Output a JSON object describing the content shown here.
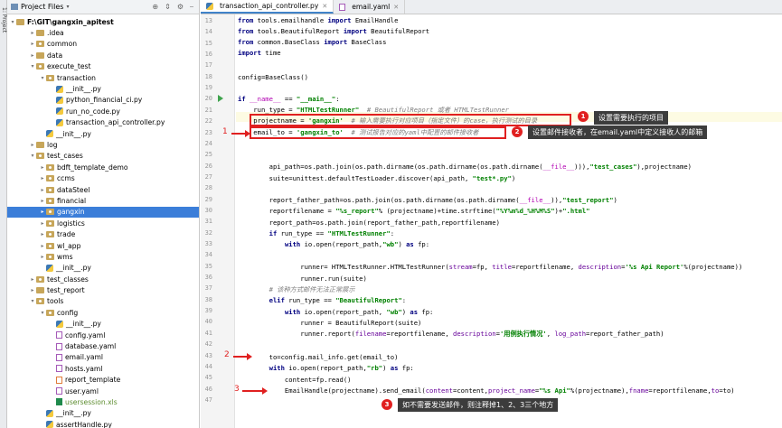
{
  "side_strip": {
    "label": "1: Project"
  },
  "project_panel": {
    "title": "Project Files",
    "root": "F:\\GIT\\gangxin_apitest",
    "tree": [
      {
        "label": ".idea",
        "indent": 2,
        "arrow": "▸",
        "icon": "folder"
      },
      {
        "label": "common",
        "indent": 2,
        "arrow": "▸",
        "icon": "pkg"
      },
      {
        "label": "data",
        "indent": 2,
        "arrow": "▸",
        "icon": "folder"
      },
      {
        "label": "execute_test",
        "indent": 2,
        "arrow": "▾",
        "icon": "pkg"
      },
      {
        "label": "transaction",
        "indent": 3,
        "arrow": "▾",
        "icon": "pkg"
      },
      {
        "label": "__init__.py",
        "indent": 4,
        "arrow": "",
        "icon": "py"
      },
      {
        "label": "python_financial_ci.py",
        "indent": 4,
        "arrow": "",
        "icon": "py"
      },
      {
        "label": "run_no_code.py",
        "indent": 4,
        "arrow": "",
        "icon": "py"
      },
      {
        "label": "transaction_api_controller.py",
        "indent": 4,
        "arrow": "",
        "icon": "py"
      },
      {
        "label": "__init__.py",
        "indent": 3,
        "arrow": "",
        "icon": "py"
      },
      {
        "label": "log",
        "indent": 2,
        "arrow": "▸",
        "icon": "folder"
      },
      {
        "label": "test_cases",
        "indent": 2,
        "arrow": "▾",
        "icon": "pkg"
      },
      {
        "label": "bdft_template_demo",
        "indent": 3,
        "arrow": "▸",
        "icon": "pkg"
      },
      {
        "label": "ccms",
        "indent": 3,
        "arrow": "▸",
        "icon": "pkg"
      },
      {
        "label": "dataSteel",
        "indent": 3,
        "arrow": "▸",
        "icon": "pkg"
      },
      {
        "label": "financial",
        "indent": 3,
        "arrow": "▸",
        "icon": "pkg"
      },
      {
        "label": "gangxin",
        "indent": 3,
        "arrow": "▸",
        "icon": "pkg",
        "selected": true
      },
      {
        "label": "logistics",
        "indent": 3,
        "arrow": "▸",
        "icon": "pkg"
      },
      {
        "label": "trade",
        "indent": 3,
        "arrow": "▸",
        "icon": "pkg"
      },
      {
        "label": "wl_app",
        "indent": 3,
        "arrow": "▸",
        "icon": "pkg"
      },
      {
        "label": "wms",
        "indent": 3,
        "arrow": "▸",
        "icon": "pkg"
      },
      {
        "label": "__init__.py",
        "indent": 3,
        "arrow": "",
        "icon": "py"
      },
      {
        "label": "test_classes",
        "indent": 2,
        "arrow": "▸",
        "icon": "pkg"
      },
      {
        "label": "test_report",
        "indent": 2,
        "arrow": "▸",
        "icon": "folder"
      },
      {
        "label": "tools",
        "indent": 2,
        "arrow": "▾",
        "icon": "pkg"
      },
      {
        "label": "config",
        "indent": 3,
        "arrow": "▾",
        "icon": "pkg"
      },
      {
        "label": "__init__.py",
        "indent": 4,
        "arrow": "",
        "icon": "py"
      },
      {
        "label": "config.yaml",
        "indent": 4,
        "arrow": "",
        "icon": "yaml"
      },
      {
        "label": "database.yaml",
        "indent": 4,
        "arrow": "",
        "icon": "yaml"
      },
      {
        "label": "email.yaml",
        "indent": 4,
        "arrow": "",
        "icon": "yaml"
      },
      {
        "label": "hosts.yaml",
        "indent": 4,
        "arrow": "",
        "icon": "yaml"
      },
      {
        "label": "report_template",
        "indent": 4,
        "arrow": "",
        "icon": "html"
      },
      {
        "label": "user.yaml",
        "indent": 4,
        "arrow": "",
        "icon": "yaml"
      },
      {
        "label": "usersession.xls",
        "indent": 4,
        "arrow": "",
        "icon": "xls",
        "green": true
      },
      {
        "label": "__init__.py",
        "indent": 3,
        "arrow": "",
        "icon": "py"
      },
      {
        "label": "assertHandle.py",
        "indent": 3,
        "arrow": "",
        "icon": "py"
      }
    ]
  },
  "tabs": [
    {
      "label": "transaction_api_controller.py",
      "active": true
    },
    {
      "label": "email.yaml",
      "active": false
    }
  ],
  "gutter": {
    "lines": [
      "13",
      "14",
      "15",
      "16",
      "17",
      "18",
      "19",
      "20",
      "21",
      "22",
      "23",
      "24",
      "25",
      "26",
      "27",
      "28",
      "29",
      "30",
      "31",
      "32",
      "33",
      "34",
      "35",
      "36",
      "37",
      "38",
      "39",
      "40",
      "41",
      "42",
      "43",
      "44",
      "45",
      "46",
      "47"
    ]
  },
  "annotations": {
    "num1_left": "1",
    "num2_left": "2",
    "num3_left": "3",
    "badge1": "1",
    "badge2": "2",
    "badge3": "3",
    "tip1": "设置需要执行的项目",
    "tip2": "设置邮件接收者，在email.yaml中定义接收人的邮箱",
    "tip3": "如不需要发送邮件，则注释掉1、2、3三个地方"
  }
}
